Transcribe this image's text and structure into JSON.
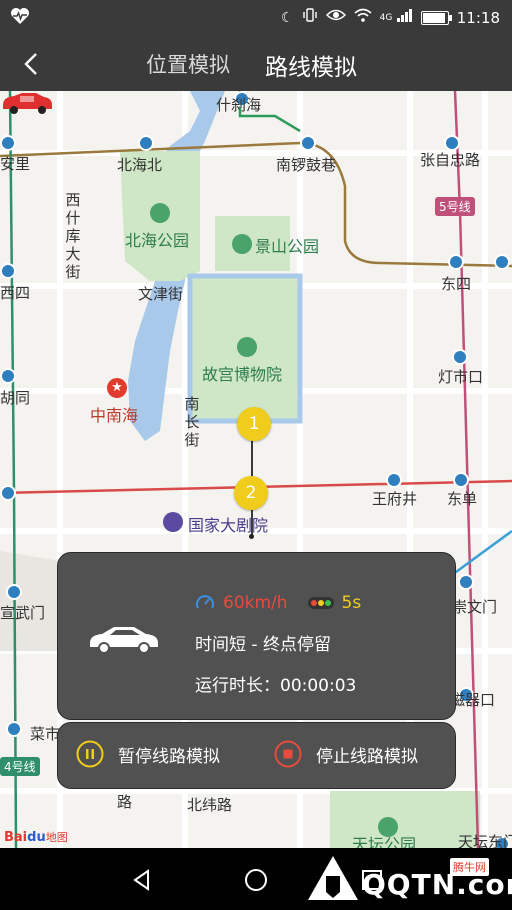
{
  "status_bar": {
    "time": "11:18",
    "network": "4G",
    "icons": [
      "heart-rate-icon",
      "moon-icon",
      "vibrate-icon",
      "eye-icon",
      "wifi-icon",
      "signal-icon",
      "battery-icon"
    ],
    "battery_level": 0.85
  },
  "header": {
    "back_icon": "chevron-left-icon",
    "tabs": [
      {
        "label": "位置模拟",
        "active": false
      },
      {
        "label": "路线模拟",
        "active": true
      }
    ]
  },
  "map": {
    "labels": {
      "shichahai": "什刹海",
      "xi_an_li": "安里",
      "beihai_north": "北海北",
      "nanluoguxiang": "南锣鼓巷",
      "zhangzizhong": "张自忠路",
      "xishiku": "西什库大街",
      "beihai_park": "北海公园",
      "jingshan": "景山公园",
      "wenjin": "文津街",
      "xisi": "西四",
      "dongsi": "东四",
      "forbidden_city": "故宫博物院",
      "dengshikou": "灯市口",
      "hutong": "胡同",
      "zhongnanhai": "中南海",
      "nanchang": "南长街",
      "wangfujing": "王府井",
      "dongdan": "东单",
      "ncpa": "国家大剧院",
      "xuanwumen": "宣武门",
      "chongwenmen": "崇文门",
      "ciqikou": "磁器口",
      "caishikou": "菜市",
      "beiwei": "北纬路",
      "lu": "路",
      "tiantan_park": "天坛公园",
      "tiantan_east": "天坛东门"
    },
    "line_badges": {
      "line5": "5号线",
      "line4": "4号线"
    },
    "waypoints": [
      "1",
      "2"
    ],
    "logo": {
      "part1": "Bai",
      "part2": "du",
      "part3": "地图"
    },
    "colors": {
      "line2": "#9a7a3c",
      "line1": "#d94a4a",
      "line5": "#c0507a",
      "line4": "#2e8f6a",
      "route": "#3a3a3a",
      "park": "#cfe7c6",
      "water": "#a9c9ea",
      "waypoint": "#f0cd1c"
    }
  },
  "info_panel": {
    "speed_icon": "speedometer-icon",
    "speed": "60km/h",
    "traffic_light_icon": "traffic-light-icon",
    "light_wait": "5s",
    "route_desc": "时间短 - 终点停留",
    "run_label": "运行时长：",
    "run_time": "00:00:03",
    "colors": {
      "speed": "#e84b3c",
      "light": "#f0cd1c"
    }
  },
  "controls": {
    "pause_label": "暂停线路模拟",
    "stop_label": "停止线路模拟",
    "pause_icon": "pause-circle-icon",
    "stop_icon": "stop-circle-icon"
  },
  "nav_bar": {
    "icons": [
      "back-triangle-icon",
      "home-circle-icon",
      "recents-square-icon"
    ]
  },
  "watermark": {
    "text": "QQTN.com",
    "badge": "腾牛网"
  }
}
